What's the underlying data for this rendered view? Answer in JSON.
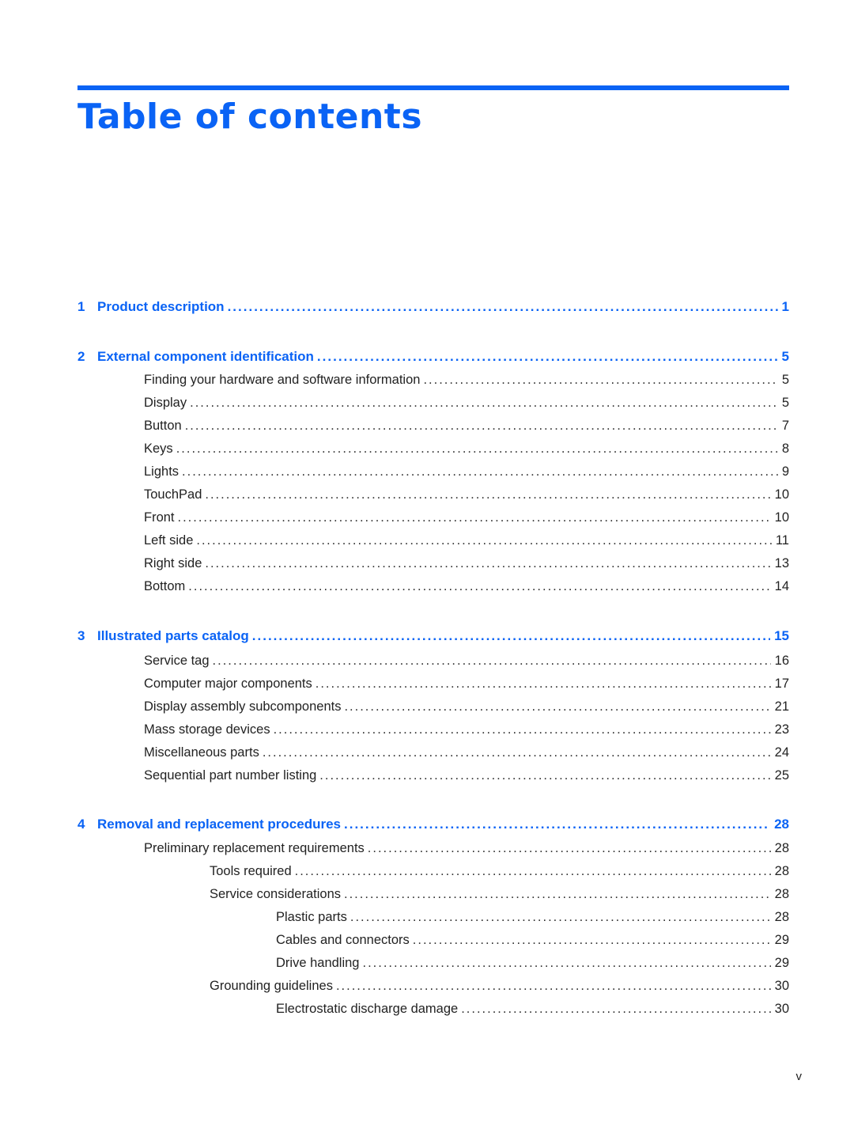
{
  "title": "Table of contents",
  "colors": {
    "accent": "#0a63f5",
    "text": "#222222"
  },
  "chapters": [
    {
      "num": "1",
      "title": "Product description",
      "page": "1",
      "entries": []
    },
    {
      "num": "2",
      "title": "External component identification",
      "page": "5",
      "entries": [
        {
          "title": "Finding your hardware and software information",
          "page": "5",
          "level": 1
        },
        {
          "title": "Display",
          "page": "5",
          "level": 1
        },
        {
          "title": "Button",
          "page": "7",
          "level": 1
        },
        {
          "title": "Keys",
          "page": "8",
          "level": 1
        },
        {
          "title": "Lights",
          "page": "9",
          "level": 1
        },
        {
          "title": "TouchPad",
          "page": "10",
          "level": 1
        },
        {
          "title": "Front",
          "page": "10",
          "level": 1
        },
        {
          "title": "Left side",
          "page": "11",
          "level": 1
        },
        {
          "title": "Right side",
          "page": "13",
          "level": 1
        },
        {
          "title": "Bottom",
          "page": "14",
          "level": 1
        }
      ]
    },
    {
      "num": "3",
      "title": "Illustrated parts catalog",
      "page": "15",
      "entries": [
        {
          "title": "Service tag",
          "page": "16",
          "level": 1
        },
        {
          "title": "Computer major components",
          "page": "17",
          "level": 1
        },
        {
          "title": "Display assembly subcomponents",
          "page": "21",
          "level": 1
        },
        {
          "title": "Mass storage devices",
          "page": "23",
          "level": 1
        },
        {
          "title": "Miscellaneous parts",
          "page": "24",
          "level": 1
        },
        {
          "title": "Sequential part number listing",
          "page": "25",
          "level": 1
        }
      ]
    },
    {
      "num": "4",
      "title": "Removal and replacement procedures",
      "page": "28",
      "entries": [
        {
          "title": "Preliminary replacement requirements",
          "page": "28",
          "level": 1
        },
        {
          "title": "Tools required",
          "page": "28",
          "level": 2
        },
        {
          "title": "Service considerations",
          "page": "28",
          "level": 2
        },
        {
          "title": "Plastic parts",
          "page": "28",
          "level": 3
        },
        {
          "title": "Cables and connectors",
          "page": "29",
          "level": 3
        },
        {
          "title": "Drive handling",
          "page": "29",
          "level": 3
        },
        {
          "title": "Grounding guidelines",
          "page": "30",
          "level": 2
        },
        {
          "title": "Electrostatic discharge damage",
          "page": "30",
          "level": 3
        }
      ]
    }
  ],
  "footer": {
    "page_number": "v"
  }
}
